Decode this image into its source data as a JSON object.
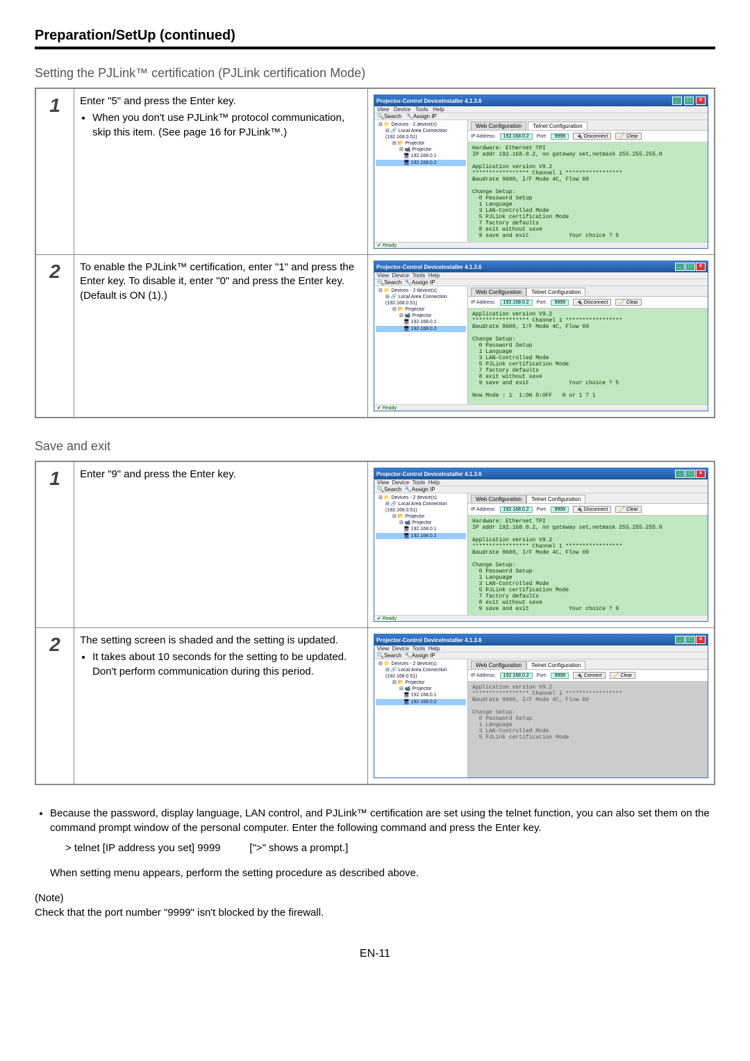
{
  "header": {
    "title": "Preparation/SetUp (continued)"
  },
  "sections": [
    {
      "subheading": "Setting the PJLink™ certification (PJLink certification Mode)"
    },
    {
      "subheading": "Save and exit"
    }
  ],
  "table1": {
    "rows": [
      {
        "num": "1",
        "text": "Enter \"5\" and press the Enter key.",
        "bullets": [
          "When you don't use PJLink™ protocol communication, skip this item. (See page 16 for PJLink™.)"
        ],
        "screenshot": "A"
      },
      {
        "num": "2",
        "text": "To enable the PJLink™ certification, enter \"1\" and press the Enter key. To disable it, enter \"0\" and press the Enter key. (Default is ON (1).)",
        "bullets": [],
        "screenshot": "B"
      }
    ]
  },
  "table2": {
    "rows": [
      {
        "num": "1",
        "text": "Enter \"9\" and press the Enter key.",
        "bullets": [],
        "screenshot": "C"
      },
      {
        "num": "2",
        "text": "The setting screen is shaded and the setting is updated.",
        "bullets": [
          "It takes about 10 seconds for the setting to be updated. Don't perform communication during this period."
        ],
        "screenshot": "D"
      }
    ]
  },
  "app": {
    "title": "Projector-Control DeviceInstaller 4.1.3.6",
    "menus": [
      "View",
      "Device",
      "Tools",
      "Help"
    ],
    "toolbar": [
      "Search",
      "Assign IP"
    ],
    "tree": {
      "root": "Devices - 2 device(s)",
      "lan": "Local Area Connection (192.168.0.51)",
      "folder": "Projector",
      "device": "Projector",
      "ip1": "192.168.0.1",
      "ip2": "192.168.0.2"
    },
    "tabs": [
      "Web Configuration",
      "Telnet Configuration"
    ],
    "conn": {
      "ip_label": "IP Address:",
      "ip": "192.168.0.2",
      "port_label": "Port:",
      "port": "9999",
      "disconnect": "Disconnect",
      "connect": "Connect",
      "clear": "Clear"
    },
    "status": "Ready",
    "terminals": {
      "A": "Hardware: Ethernet TPI\nIP addr 192.168.0.2, no gateway set,netmask 255.255.255.0\n\nApplication version V9.2\n***************** Channel 1 *****************\nBaudrate 9600, I/F Mode 4C, Flow 00\n\nChange Setup:\n  0 Password Setup\n  1 Language\n  3 LAN-Controlled Mode\n  5 PJLink certification Mode\n  7 factory defaults\n  8 exit without save\n  9 save and exit            Your choice ? 5",
      "B": "Application version V9.2\n***************** Channel 1 *****************\nBaudrate 9600, I/F Mode 4C, Flow 00\n\nChange Setup:\n  0 Password Setup\n  1 Language\n  3 LAN-Controlled Mode\n  5 PJLink certification Mode\n  7 factory defaults\n  8 exit without save\n  9 save and exit            Your choice ? 5\n\nNow Mode : 1  1:ON 0:OFF   0 or 1 ? 1",
      "C": "Hardware: Ethernet TPI\nIP addr 192.168.0.2, no gateway set,netmask 255.255.255.0\n\nApplication version V9.2\n***************** Channel 1 *****************\nBaudrate 9600, I/F Mode 4C, Flow 00\n\nChange Setup:\n  0 Password Setup\n  1 Language\n  3 LAN-Controlled Mode\n  5 PJLink certification Mode\n  7 factory defaults\n  8 exit without save\n  9 save and exit            Your choice ? 9",
      "D": "Application version V9.2\n***************** Channel 1 *****************\nBaudrate 9600, I/F Mode 4C, Flow 00\n\nChange Setup:\n  0 Password Setup\n  1 Language\n  3 LAN-Controlled Mode\n  5 PJLink certification Mode"
    }
  },
  "notes": {
    "bullet": "Because the password, display language, LAN control, and PJLink™ certification are set using the telnet function, you can also set them on the command prompt window of the personal computer. Enter the following command and press the Enter key.",
    "command": "> telnet [IP address you set] 9999",
    "hint": "[\">\" shows a prompt.]",
    "after": "When setting menu appears, perform the setting procedure as described above.",
    "note_label": "(Note)",
    "note_body": "Check that the port number \"9999\" isn't blocked by the firewall."
  },
  "page_number": "EN-11"
}
